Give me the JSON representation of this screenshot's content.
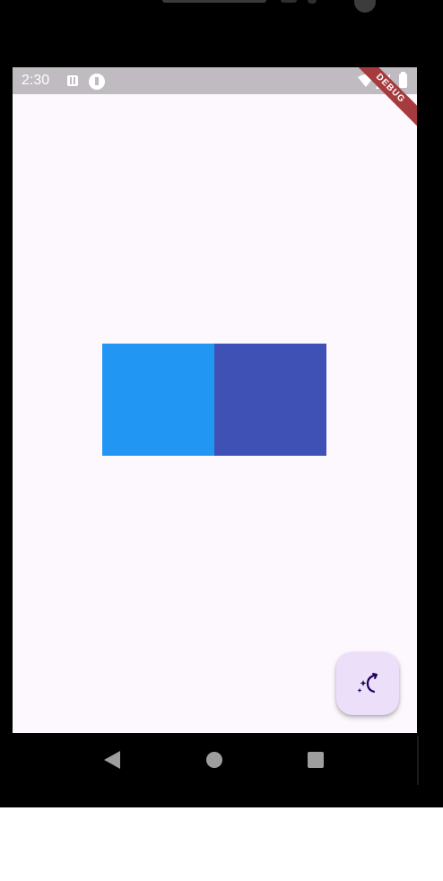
{
  "status_bar": {
    "time": "2:30",
    "icons": [
      "android-notification-icon",
      "app-notification-icon",
      "wifi-icon",
      "signal-icon",
      "battery-icon"
    ]
  },
  "debug_banner": {
    "label": "DEBUG"
  },
  "colors": {
    "box_left": "#2196f3",
    "box_right": "#3f51b5",
    "fab_background": "#ebdff9",
    "fab_icon": "#21005d",
    "screen_background": "#fdf7fe",
    "status_bar_background": "#bfbbc1"
  },
  "fab": {
    "icon": "magic-moon-icon"
  },
  "nav_bar": {
    "buttons": [
      "back-icon",
      "home-icon",
      "recent-apps-icon"
    ]
  }
}
